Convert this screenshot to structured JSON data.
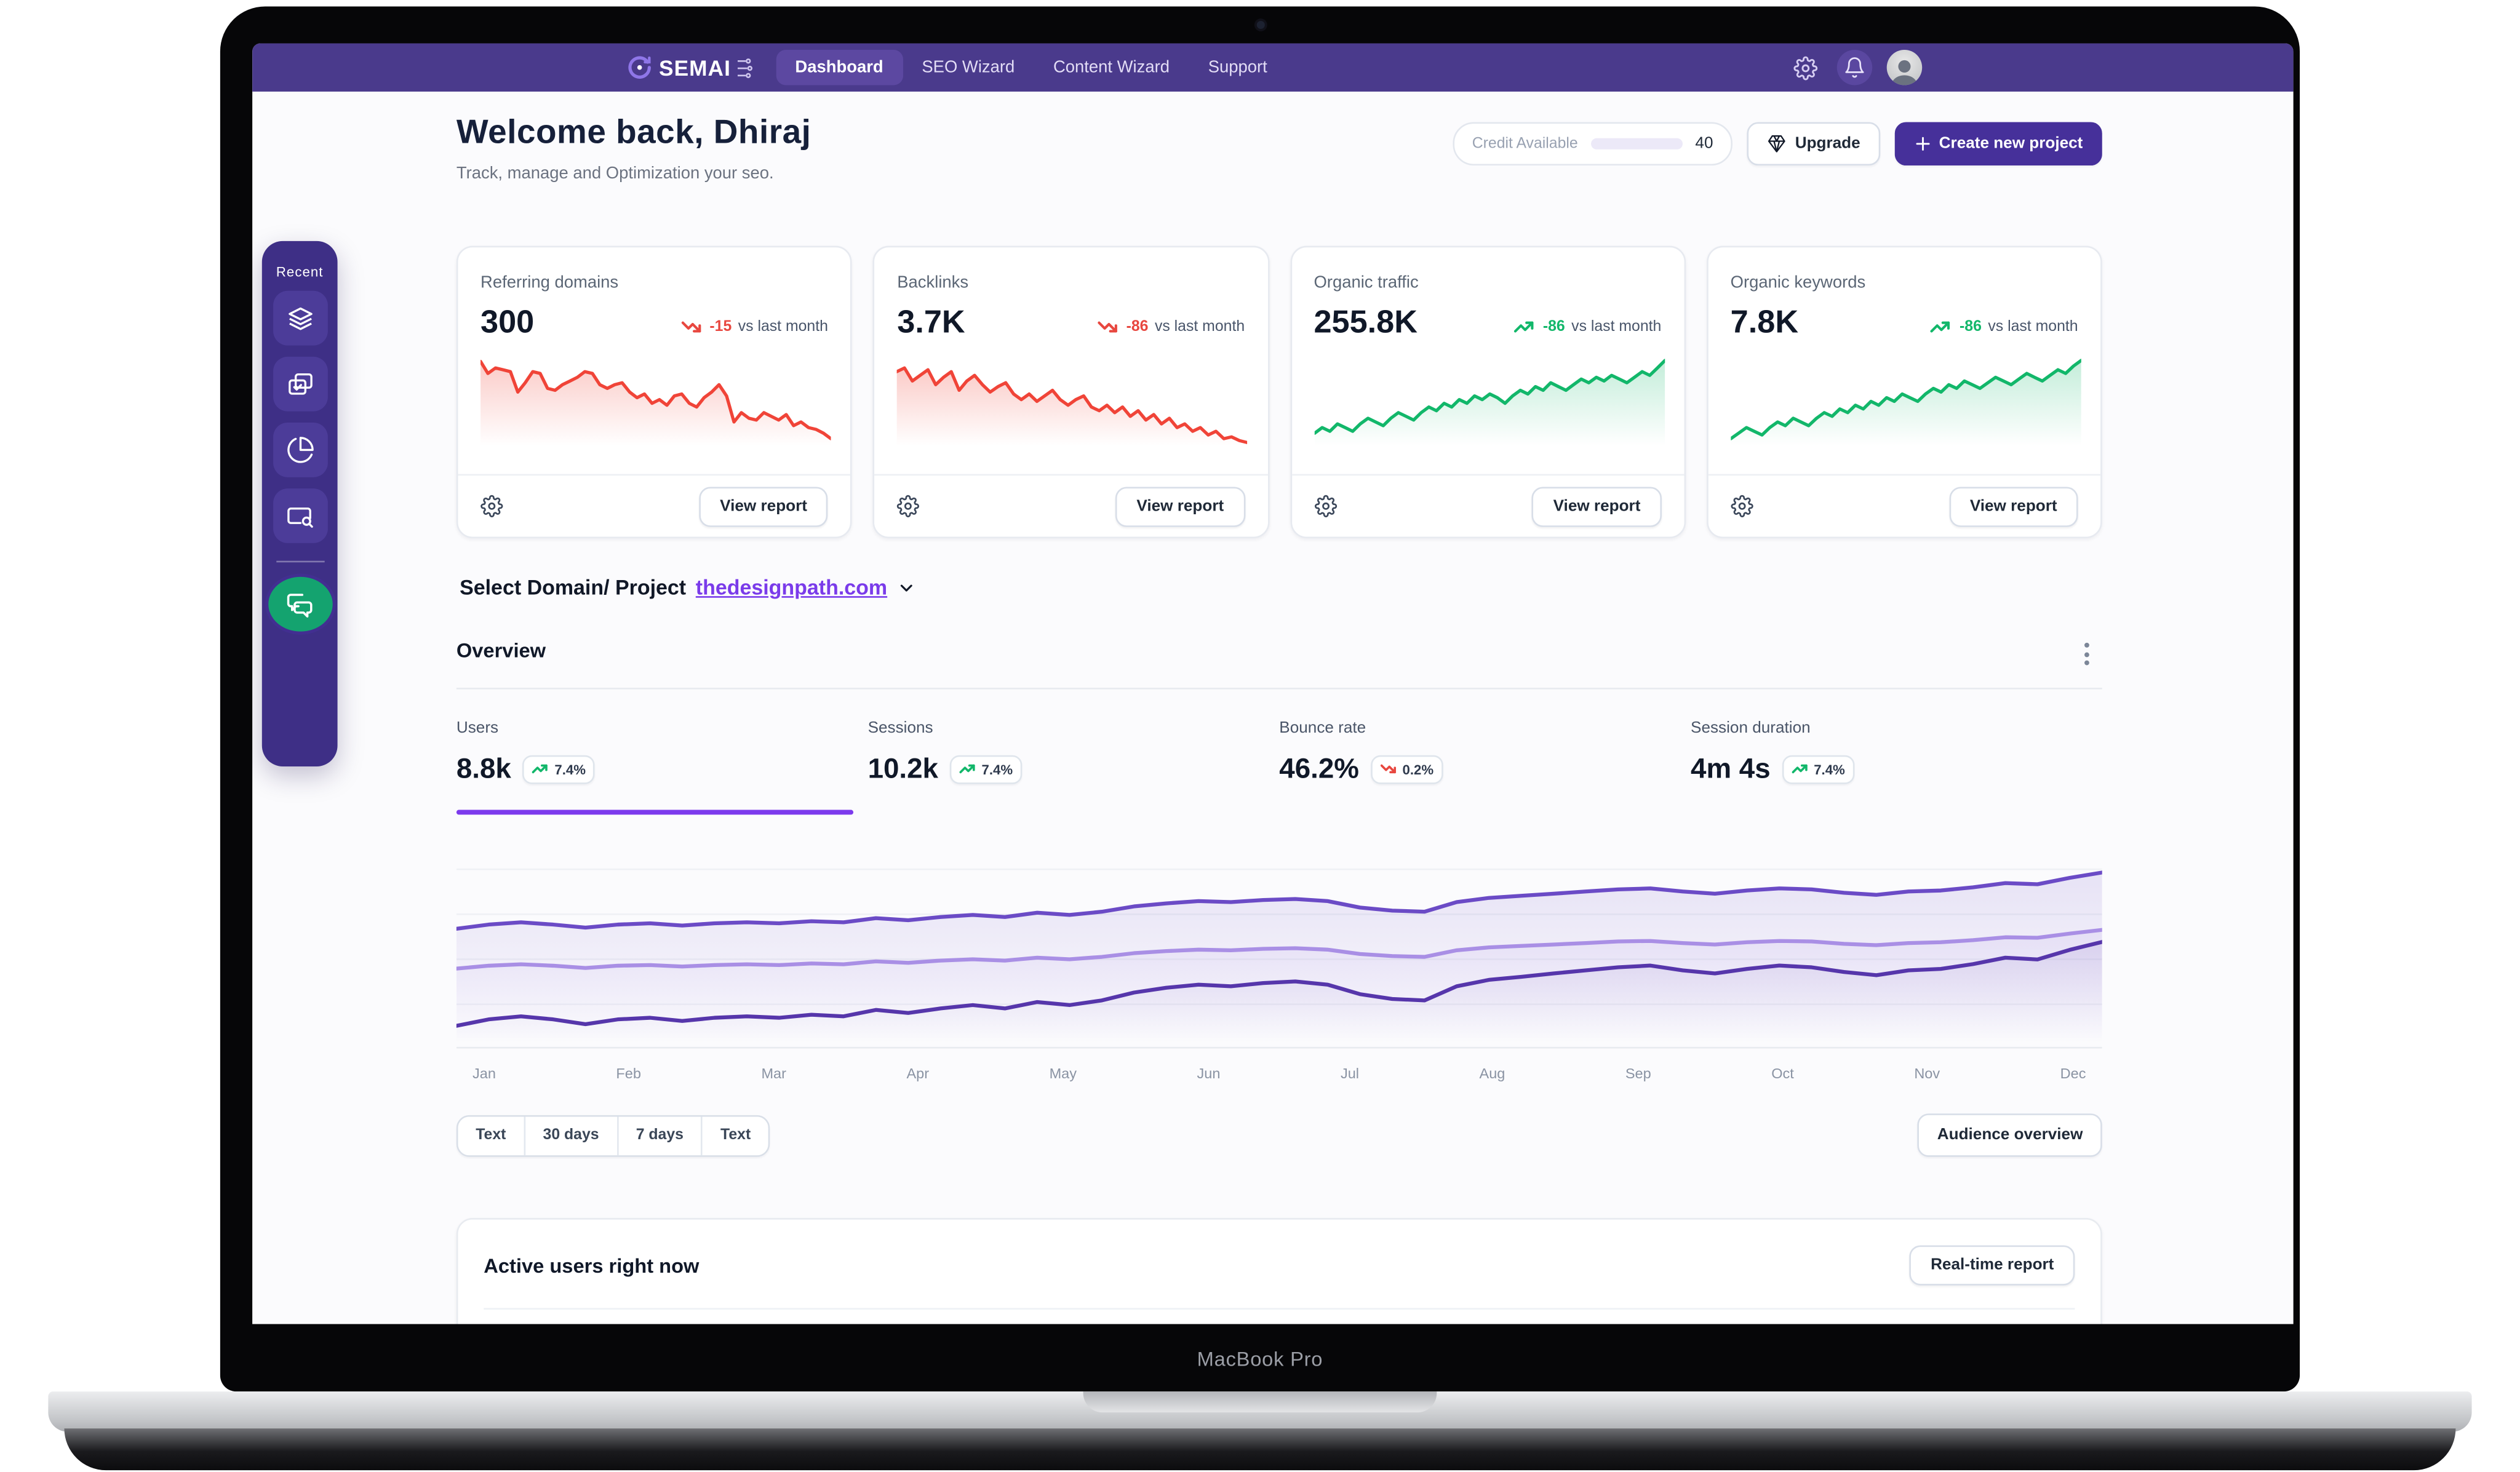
{
  "device": {
    "label": "MacBook Pro"
  },
  "navbar": {
    "brand": "SEMAI",
    "items": [
      {
        "label": "Dashboard",
        "active": true
      },
      {
        "label": "SEO Wizard",
        "active": false
      },
      {
        "label": "Content Wizard",
        "active": false
      },
      {
        "label": "Support",
        "active": false
      }
    ],
    "icons": [
      "settings-gear",
      "notification-bell",
      "user-avatar"
    ]
  },
  "header": {
    "title": "Welcome back, Dhiraj",
    "subtitle": "Track, manage and Optimization your seo.",
    "credit": {
      "label": "Credit Available",
      "value": "40",
      "progress_percent": 100
    },
    "upgrade_label": "Upgrade",
    "create_label": "Create new project"
  },
  "sidebar": {
    "title": "Recent",
    "icons": [
      "layers",
      "tasks-copy",
      "pie-chart",
      "card-search",
      "chat-bubbles"
    ]
  },
  "stat_cards": [
    {
      "label": "Referring domains",
      "value": "300",
      "delta": "-15",
      "trend": "down",
      "compare": "vs last month",
      "action": "View report",
      "spark": [
        95,
        82,
        88,
        86,
        84,
        62,
        72,
        84,
        82,
        66,
        64,
        70,
        74,
        78,
        84,
        82,
        70,
        66,
        70,
        72,
        62,
        56,
        60,
        50,
        54,
        48,
        58,
        60,
        50,
        46,
        56,
        62,
        70,
        58,
        30,
        40,
        34,
        32,
        40,
        36,
        32,
        38,
        26,
        30,
        24,
        22,
        18,
        12
      ]
    },
    {
      "label": "Backlinks",
      "value": "3.7K",
      "delta": "-86",
      "trend": "down",
      "compare": "vs last month",
      "action": "View report",
      "spark": [
        84,
        88,
        74,
        80,
        86,
        70,
        78,
        84,
        64,
        74,
        80,
        70,
        62,
        68,
        72,
        60,
        54,
        60,
        52,
        58,
        64,
        54,
        48,
        54,
        58,
        46,
        42,
        48,
        40,
        46,
        36,
        42,
        32,
        38,
        28,
        34,
        24,
        28,
        20,
        24,
        16,
        20,
        12,
        14,
        10,
        8
      ]
    },
    {
      "label": "Organic traffic",
      "value": "255.8K",
      "delta": "-86",
      "trend": "up",
      "compare": "vs last month",
      "action": "View report",
      "spark": [
        18,
        24,
        20,
        28,
        24,
        20,
        28,
        34,
        30,
        26,
        34,
        40,
        36,
        32,
        40,
        46,
        42,
        50,
        46,
        54,
        50,
        58,
        54,
        60,
        56,
        50,
        58,
        64,
        60,
        68,
        64,
        72,
        68,
        64,
        70,
        76,
        72,
        78,
        74,
        80,
        76,
        72,
        78,
        84,
        80,
        88,
        96
      ]
    },
    {
      "label": "Organic keywords",
      "value": "7.8K",
      "delta": "-86",
      "trend": "up",
      "compare": "vs last month",
      "action": "View report",
      "spark": [
        12,
        18,
        24,
        20,
        16,
        24,
        30,
        26,
        34,
        30,
        26,
        34,
        40,
        36,
        44,
        40,
        48,
        44,
        52,
        48,
        56,
        52,
        60,
        56,
        52,
        60,
        66,
        62,
        70,
        66,
        74,
        70,
        66,
        72,
        78,
        74,
        70,
        76,
        82,
        78,
        74,
        80,
        86,
        82,
        90,
        96
      ]
    }
  ],
  "domain_selector": {
    "label": "Select Domain/ Project",
    "value": "thedesignpath.com"
  },
  "overview": {
    "title": "Overview",
    "metrics": [
      {
        "label": "Users",
        "value": "8.8k",
        "delta": "7.4%",
        "trend": "up",
        "active": true
      },
      {
        "label": "Sessions",
        "value": "10.2k",
        "delta": "7.4%",
        "trend": "up",
        "active": false
      },
      {
        "label": "Bounce rate",
        "value": "46.2%",
        "delta": "0.2%",
        "trend": "down",
        "active": false
      },
      {
        "label": "Session duration",
        "value": "4m 4s",
        "delta": "7.4%",
        "trend": "up",
        "active": false
      }
    ]
  },
  "chart_data": {
    "type": "line",
    "title": "Overview — Users trend by month",
    "x": [
      "Jan",
      "Feb",
      "Mar",
      "Apr",
      "May",
      "Jun",
      "Jul",
      "Aug",
      "Sep",
      "Oct",
      "Nov",
      "Dec"
    ],
    "ylim": [
      0,
      100
    ],
    "grid": true,
    "legend": "none",
    "series": [
      {
        "name": "upper",
        "color": "#6b4bc6",
        "fill_opacity": 0.14,
        "values": [
          62.5,
          64.7,
          65.8,
          64.7,
          63.1,
          64.7,
          65.3,
          64.2,
          65.3,
          65.8,
          65.3,
          66.4,
          65.8,
          68,
          66.9,
          68.6,
          69.7,
          68.6,
          70.8,
          69.7,
          71.3,
          74.1,
          75.7,
          76.8,
          76.3,
          77.4,
          77.9,
          76.8,
          73.5,
          71.9,
          71.3,
          76.3,
          78.5,
          79.6,
          80.7,
          81.8,
          82.9,
          83.4,
          81.8,
          80.7,
          82.3,
          83.4,
          82.9,
          81.2,
          80.1,
          81.8,
          82.3,
          84,
          86.2,
          85.6,
          88.9,
          91.7
        ]
      },
      {
        "name": "middle",
        "color": "#a98fe5",
        "fill_opacity": 0.13,
        "values": [
          41.8,
          43.3,
          44.1,
          43.3,
          42.2,
          43.3,
          43.7,
          42.9,
          43.7,
          44.1,
          43.7,
          44.5,
          44.1,
          45.6,
          44.8,
          46,
          46.7,
          46,
          47.5,
          46.7,
          47.9,
          49.8,
          50.9,
          51.7,
          51.3,
          52.1,
          52.4,
          51.7,
          49.4,
          48.3,
          47.9,
          51.3,
          52.8,
          53.6,
          54.3,
          55.1,
          55.9,
          56.2,
          55.1,
          54.3,
          55.5,
          56.2,
          55.9,
          54.7,
          54,
          55.1,
          55.5,
          56.6,
          58.1,
          57.8,
          60,
          61.9
        ]
      },
      {
        "name": "lower",
        "color": "#5636ab",
        "fill_opacity": 0.1,
        "values": [
          12.2,
          15.5,
          17.1,
          15.5,
          13,
          15.5,
          16.3,
          14.7,
          16.3,
          17.1,
          16.3,
          17.9,
          17.1,
          20.4,
          18.8,
          21.2,
          22.9,
          21.2,
          24.5,
          22.9,
          25.3,
          29.4,
          31.9,
          33.5,
          32.7,
          34.3,
          35.2,
          33.5,
          28.6,
          26.1,
          25.3,
          32.7,
          36,
          37.6,
          39.3,
          40.9,
          42.5,
          43.4,
          40.9,
          39.3,
          41.7,
          43.4,
          42.5,
          40.1,
          38.4,
          40.9,
          41.7,
          44.2,
          47.5,
          46.6,
          51.6,
          55.7
        ]
      }
    ]
  },
  "filters": {
    "options": [
      "Text",
      "30 days",
      "7 days",
      "Text"
    ],
    "audience_label": "Audience overview"
  },
  "active_users": {
    "title": "Active users right now",
    "action": "Real-time report"
  },
  "colors": {
    "nav": "#4a3a8c",
    "accent": "#7c3aed",
    "primary_button": "#46309a",
    "positive": "#12b76a",
    "negative": "#e8473f",
    "spark_down": "#f04438",
    "spark_up": "#12b76a"
  }
}
